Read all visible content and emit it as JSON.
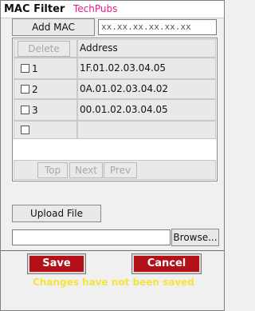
{
  "header": {
    "title": "MAC Filter",
    "subtitle": "TechPubs"
  },
  "add": {
    "button_label": "Add MAC",
    "input_value": "xx.xx.xx.xx.xx.xx"
  },
  "table": {
    "delete_label": "Delete",
    "column_header": "Address",
    "rows": [
      {
        "index": "1",
        "address": "1F.01.02.03.04.05",
        "checked": false
      },
      {
        "index": "2",
        "address": "0A.01.02.03.04.02",
        "checked": false
      },
      {
        "index": "3",
        "address": "00.01.02.03.04.05",
        "checked": false
      },
      {
        "index": "",
        "address": "",
        "checked": false
      }
    ],
    "nav": {
      "top": "Top",
      "next": "Next",
      "prev": "Prev"
    }
  },
  "upload": {
    "button_label": "Upload File",
    "browse_label": "Browse..."
  },
  "actions": {
    "save": "Save",
    "cancel": "Cancel",
    "status": "Changes have not been saved"
  },
  "colors": {
    "subtitle": "#e01a8c",
    "action_button": "#b31018",
    "status_text": "#f2e63c"
  }
}
